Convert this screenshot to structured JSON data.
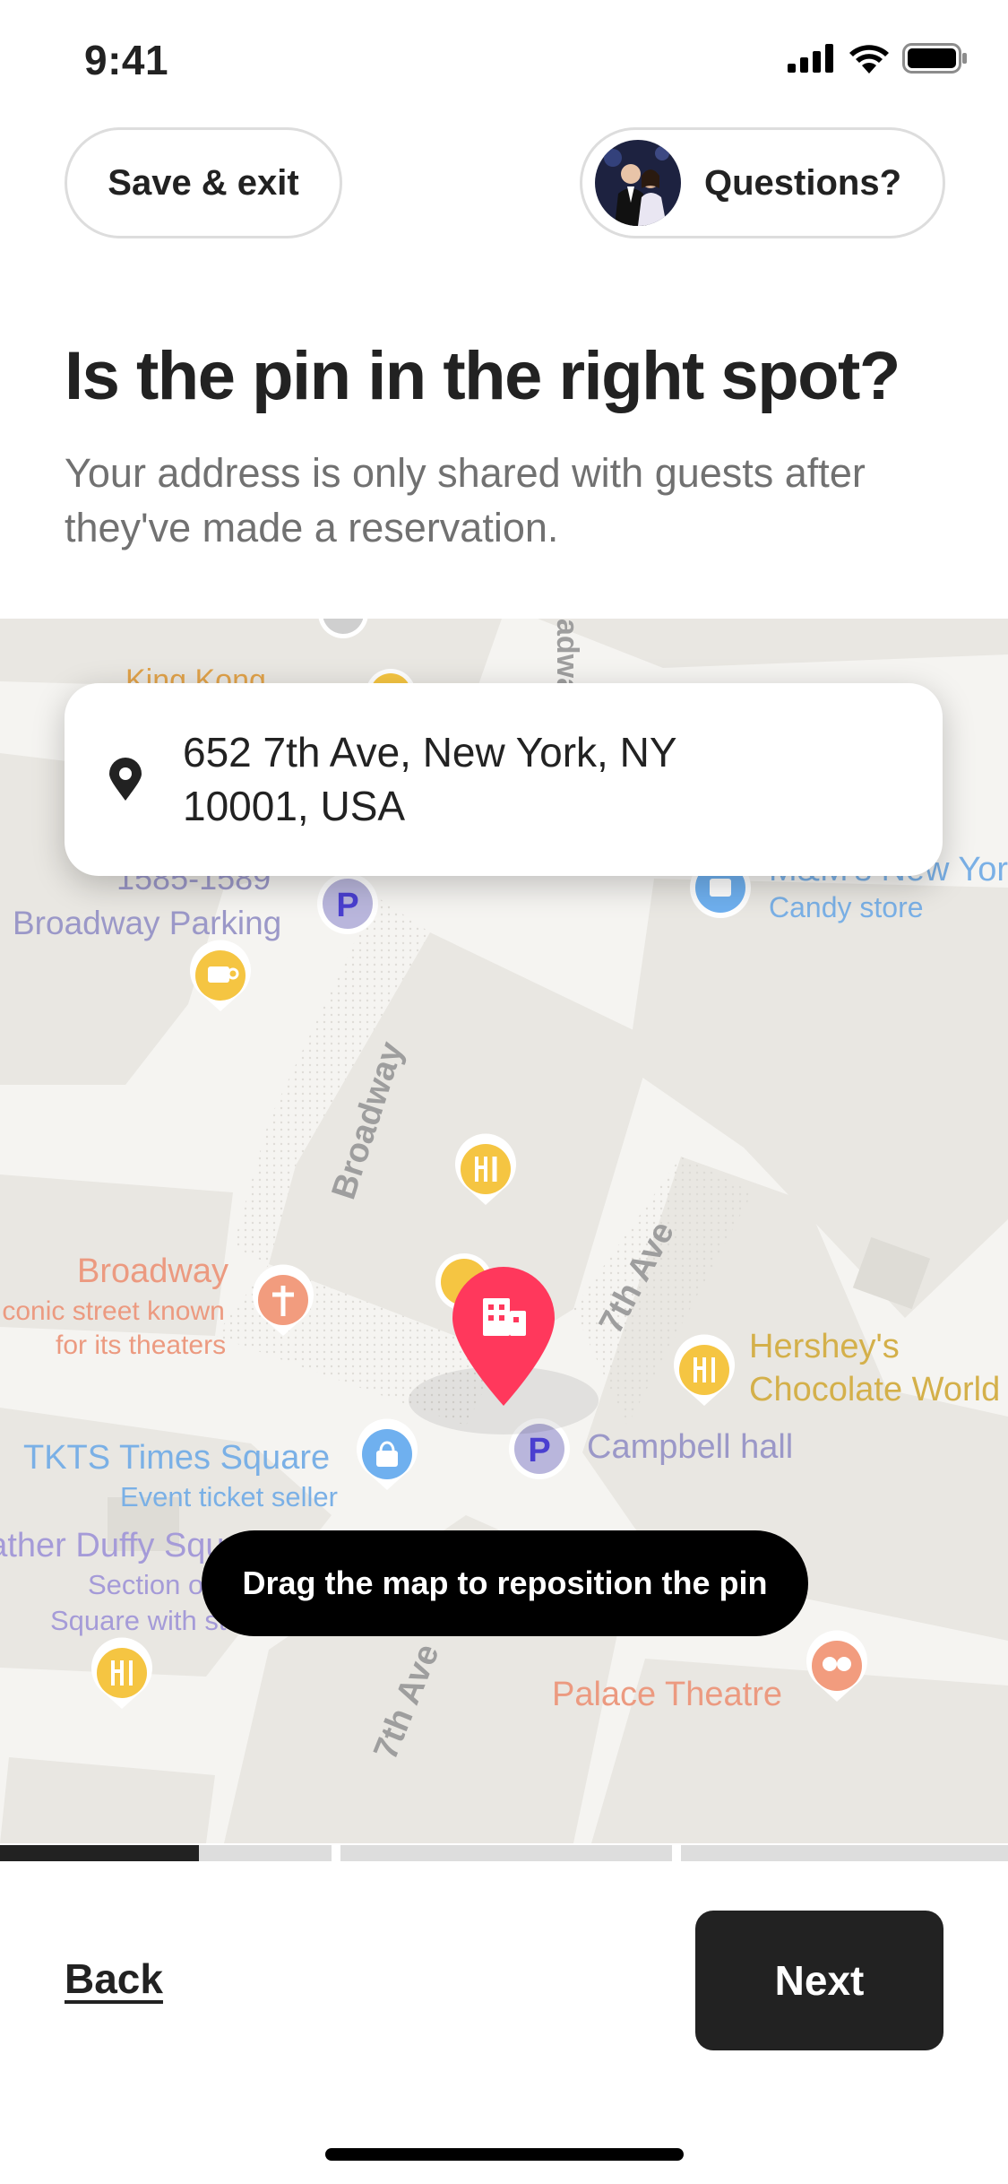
{
  "status_bar": {
    "time": "9:41"
  },
  "header": {
    "save_label": "Save & exit",
    "questions_label": "Questions?"
  },
  "page": {
    "title": "Is the pin in the right spot?",
    "subtitle": "Your address is only shared with guests after they've made a reservation."
  },
  "address": {
    "line1": "652 7th Ave, New York, NY",
    "line2": "10001, USA"
  },
  "map": {
    "streets": {
      "broadway": "Broadway",
      "seventh_ave": "7th Ave",
      "seventh_ave_lower": "7th Ave"
    },
    "pois": {
      "kings_kong": "King Kong",
      "parking_address": "1585-1589",
      "broadway_parking": "Broadway Parking",
      "mms_store": "M&M's New York",
      "mms_category": "Candy store",
      "broadway_poi": "Broadway",
      "broadway_desc1": "Iconic street known",
      "broadway_desc2": "for its theaters",
      "hersheys1": "Hershey's",
      "hersheys2": "Chocolate World",
      "campbell": "Campbell hall",
      "tkts": "TKTS Times Square",
      "tkts_category": "Event ticket seller",
      "father_duffy": "Father Duffy Square",
      "father_duffy_desc1": "Section of Times",
      "father_duffy_desc2": "Square with statues",
      "palace": "Palace Theatre"
    },
    "toast": "Drag the map to reposition the pin"
  },
  "progress": {
    "completed_fraction": 0.2
  },
  "footer": {
    "back_label": "Back",
    "next_label": "Next"
  },
  "colors": {
    "brand_pin": "#FF385C",
    "text_primary": "#222222",
    "text_secondary": "#717171",
    "map_background": "#ECEBE7",
    "poi_food": "#F5C542",
    "poi_parking": "#5B54C9",
    "poi_shop": "#4A9BE8",
    "poi_entertainment": "#F29C7E"
  }
}
